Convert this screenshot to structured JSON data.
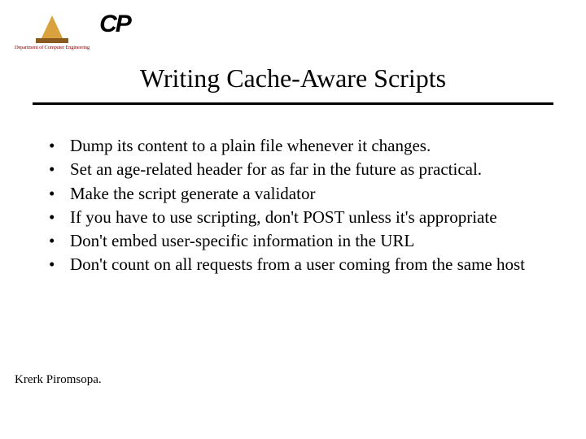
{
  "logos": {
    "dept_caption": "Department of Computer Engineering",
    "cp_text": "CP"
  },
  "title": "Writing Cache-Aware Scripts",
  "bullets": [
    "Dump its content to a plain file whenever it changes.",
    "Set an age-related header for as far in the future as practical.",
    "Make the script generate a validator",
    "If you have to use scripting, don't POST unless it's appropriate",
    "Don't embed user-specific information in the URL",
    "Don't count on all requests from a user coming from the same host"
  ],
  "footer": "Krerk Piromsopa."
}
